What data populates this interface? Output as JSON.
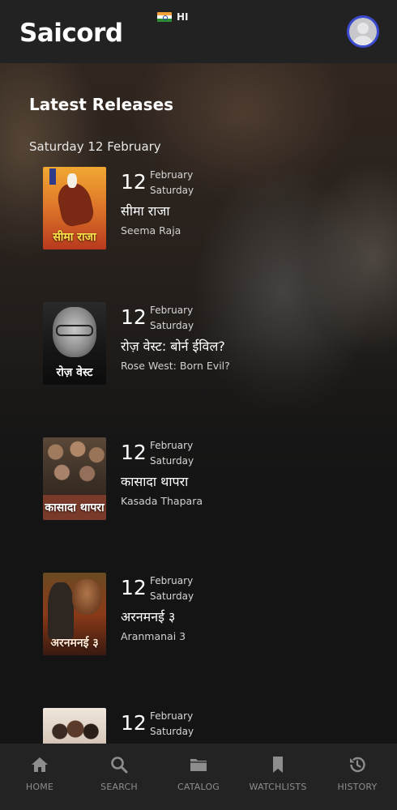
{
  "header": {
    "logo": "Saicord",
    "language_code": "HI",
    "flag": "india-flag-icon",
    "avatar": "user-avatar"
  },
  "main": {
    "section_title": "Latest Releases",
    "date_heading": "Saturday 12 February",
    "releases": [
      {
        "day": "12",
        "month": "February",
        "weekday": "Saturday",
        "title_hi": "सीमा राजा",
        "title_en": "Seema Raja",
        "poster_text": "सीमा राजा"
      },
      {
        "day": "12",
        "month": "February",
        "weekday": "Saturday",
        "title_hi": "रोज़ वेस्ट: बोर्न ईविल?",
        "title_en": "Rose West: Born Evil?",
        "poster_text": "रोज़ वेस्ट"
      },
      {
        "day": "12",
        "month": "February",
        "weekday": "Saturday",
        "title_hi": "कासादा थापरा",
        "title_en": "Kasada Thapara",
        "poster_text": "कासादा थापरा"
      },
      {
        "day": "12",
        "month": "February",
        "weekday": "Saturday",
        "title_hi": "अरनमनई ३",
        "title_en": "Aranmanai 3",
        "poster_text": "अरनमनई ३"
      },
      {
        "day": "12",
        "month": "February",
        "weekday": "Saturday",
        "title_hi": "",
        "title_en": "",
        "poster_text": ""
      }
    ]
  },
  "bottom_nav": {
    "items": [
      {
        "label": "HOME",
        "icon": "home-icon"
      },
      {
        "label": "SEARCH",
        "icon": "search-icon"
      },
      {
        "label": "CATALOG",
        "icon": "folder-icon"
      },
      {
        "label": "WATCHLISTS",
        "icon": "bookmark-icon"
      },
      {
        "label": "HISTORY",
        "icon": "history-icon"
      }
    ],
    "icon_color": "#8d8d8d"
  },
  "colors": {
    "background": "#141414",
    "topbar": "#222222",
    "bottom_nav": "#232323",
    "avatar_ring": "#3d4bd0"
  }
}
